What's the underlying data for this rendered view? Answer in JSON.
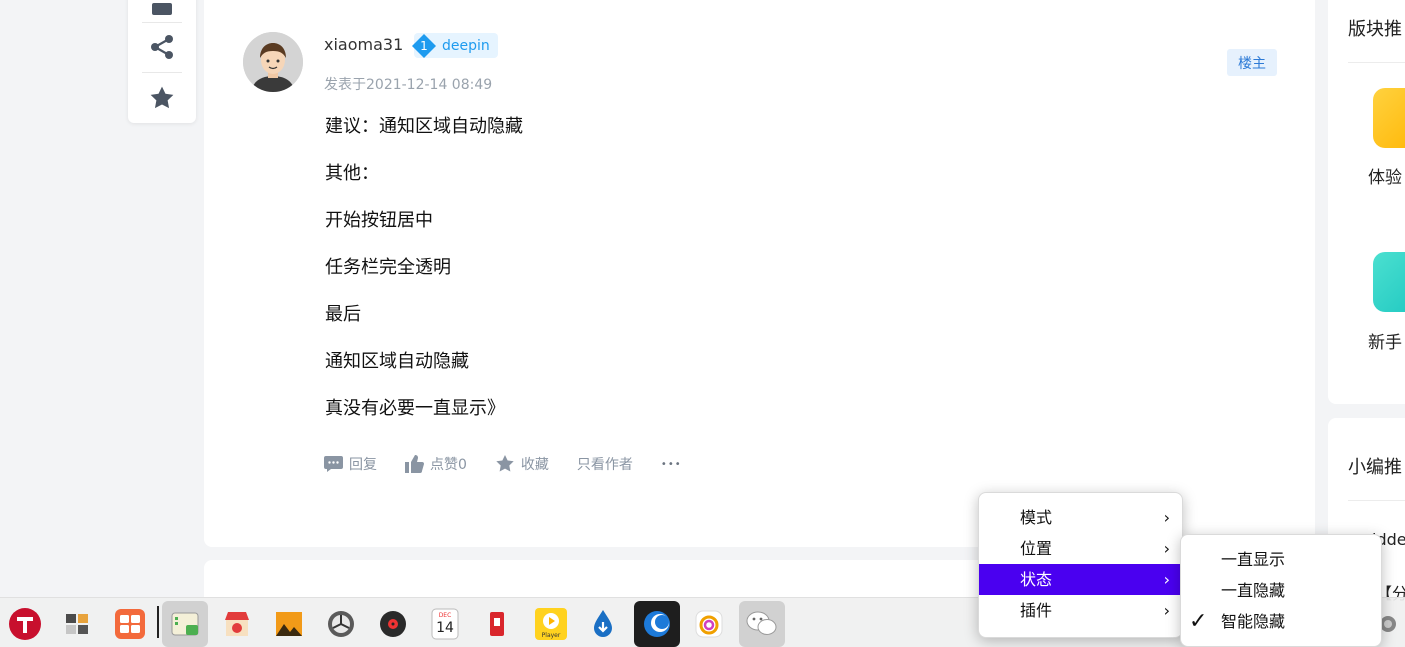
{
  "post": {
    "username": "xiaoma31",
    "level": "1",
    "badge_name": "deepin",
    "time": "发表于2021-12-14 08:49",
    "owner_tag": "楼主",
    "lines": [
      "建议：通知区域自动隐藏",
      "其他：",
      "开始按钮居中",
      "任务栏完全透明",
      "最后",
      "通知区域自动隐藏",
      "真没有必要一直显示》"
    ],
    "actions": {
      "reply": "回复",
      "like": "点赞0",
      "favorite": "收藏",
      "author_only": "只看作者",
      "more": "•••"
    }
  },
  "sidebar": {
    "section1_title": "版块推",
    "tile1_label": "体验",
    "tile2_label": "新手",
    "section2_title": "小编推",
    "item1": "idde",
    "item2": "【分"
  },
  "menu": {
    "items": [
      "模式",
      "位置",
      "状态",
      "插件"
    ],
    "arrow": "›"
  },
  "submenu": {
    "items": [
      "一直显示",
      "一直隐藏",
      "智能隐藏"
    ],
    "check": "✓"
  },
  "dock": {
    "calendar_month": "DEC",
    "calendar_day": "14",
    "player_label": "Player"
  },
  "colors": {
    "menu_highlight": "#4a00f0",
    "badge_blue": "#1e9bef"
  }
}
